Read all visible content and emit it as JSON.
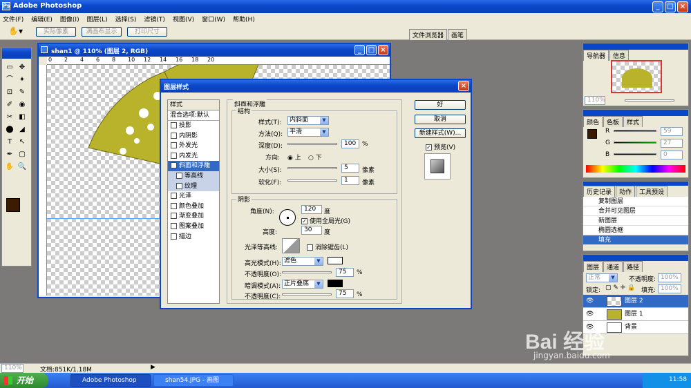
{
  "app": {
    "title": "Adobe Photoshop"
  },
  "menu": [
    "文件(F)",
    "编辑(E)",
    "图像(I)",
    "图层(L)",
    "选择(S)",
    "滤镜(T)",
    "视图(V)",
    "窗口(W)",
    "帮助(H)"
  ],
  "options_bar": {
    "buttons": [
      "实际像素",
      "满画布显示",
      "打印尺寸"
    ],
    "tabs": [
      "文件浏览器",
      "画笔"
    ]
  },
  "document": {
    "title": "shan1 @ 110% (图层 2, RGB)",
    "ruler_labels": [
      "0",
      "2",
      "4",
      "6",
      "8",
      "10",
      "12",
      "14",
      "16",
      "18",
      "20"
    ]
  },
  "status": {
    "zoom": "110%",
    "doc_info": "文档:851K/1.18M"
  },
  "dialog": {
    "title": "图层样式",
    "styles_header": "样式",
    "blend_options": "混合选项:默认",
    "effects": [
      {
        "label": "投影",
        "checked": false,
        "sub": false
      },
      {
        "label": "内阴影",
        "checked": false,
        "sub": false
      },
      {
        "label": "外发光",
        "checked": false,
        "sub": false
      },
      {
        "label": "内发光",
        "checked": false,
        "sub": false
      },
      {
        "label": "斜面和浮雕",
        "checked": true,
        "sub": false,
        "selected": true
      },
      {
        "label": "等高线",
        "checked": false,
        "sub": true
      },
      {
        "label": "纹理",
        "checked": false,
        "sub": true
      },
      {
        "label": "光泽",
        "checked": false,
        "sub": false
      },
      {
        "label": "颜色叠加",
        "checked": false,
        "sub": false
      },
      {
        "label": "渐变叠加",
        "checked": false,
        "sub": false
      },
      {
        "label": "图案叠加",
        "checked": false,
        "sub": false
      },
      {
        "label": "描边",
        "checked": false,
        "sub": false
      }
    ],
    "section_title": "斜面和浮雕",
    "structure": {
      "title": "结构",
      "style_label": "样式(T):",
      "style_value": "内斜面",
      "technique_label": "方法(Q):",
      "technique_value": "平滑",
      "depth_label": "深度(D):",
      "depth_value": "100",
      "depth_unit": "%",
      "direction_label": "方向:",
      "dir_up": "上",
      "dir_down": "下",
      "size_label": "大小(S):",
      "size_value": "5",
      "size_unit": "像素",
      "soften_label": "软化(F):",
      "soften_value": "1",
      "soften_unit": "像素"
    },
    "shading": {
      "title": "阴影",
      "angle_label": "角度(N):",
      "angle_value": "120",
      "angle_unit": "度",
      "global_light": "使用全局光(G)",
      "altitude_label": "高度:",
      "altitude_value": "30",
      "altitude_unit": "度",
      "gloss_label": "光泽等高线:",
      "antialias": "消除锯齿(L)",
      "highlight_label": "高光模式(H):",
      "highlight_value": "滤色",
      "highlight_color": "#ffffff",
      "hl_opacity_label": "不透明度(O):",
      "hl_opacity_value": "75",
      "hl_opacity_unit": "%",
      "shadow_label": "暗调模式(A):",
      "shadow_value": "正片叠底",
      "shadow_color": "#000000",
      "sh_opacity_label": "不透明度(C):",
      "sh_opacity_value": "75",
      "sh_opacity_unit": "%"
    },
    "buttons": {
      "ok": "好",
      "cancel": "取消",
      "new_style": "新建样式(W)...",
      "preview": "预览(V)"
    }
  },
  "navigator": {
    "tabs": [
      "导航器",
      "信息"
    ],
    "zoom": "110%"
  },
  "color": {
    "tabs": [
      "颜色",
      "色板",
      "样式"
    ],
    "channels": [
      {
        "label": "R",
        "value": "59"
      },
      {
        "label": "G",
        "value": "27"
      },
      {
        "label": "B",
        "value": "0"
      }
    ],
    "fg": "#3b1b00"
  },
  "history": {
    "tabs": [
      "历史记录",
      "动作",
      "工具预设"
    ],
    "items": [
      "复制图层",
      "合并可见图层",
      "新图层",
      "椭圆选框",
      "填充"
    ]
  },
  "layers": {
    "tabs": [
      "图层",
      "通道",
      "路径"
    ],
    "blend": "正常",
    "opacity_label": "不透明度:",
    "opacity_value": "100%",
    "lock_label": "锁定:",
    "fill_label": "填充:",
    "fill_value": "100%",
    "items": [
      "图层 2",
      "图层 1",
      "背景"
    ]
  },
  "taskbar": {
    "start": "开始",
    "tasks": [
      "Adobe Photoshop",
      "shan54.JPG - 画图"
    ],
    "time": "11:58"
  },
  "watermark": {
    "brand": "Bai 经验",
    "url": "jingyan.baidu.com"
  },
  "colors": {
    "fan": "#b8b32a",
    "accent": "#316ac5"
  }
}
